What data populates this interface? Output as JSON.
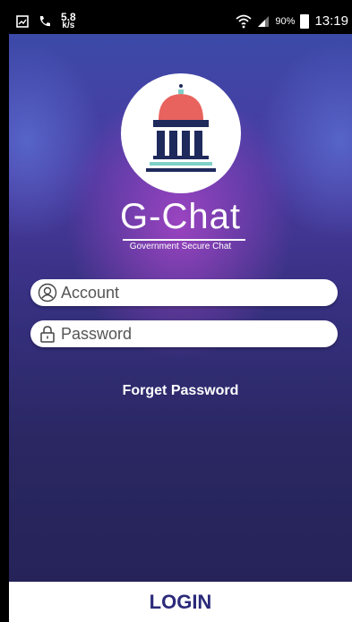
{
  "status_bar": {
    "speed_value": "5.8",
    "speed_unit": "k/s",
    "battery": "90%",
    "time": "13:19",
    "icons": [
      "gallery-icon",
      "phone-icon",
      "wifi-icon",
      "signal-icon",
      "battery-icon"
    ]
  },
  "app": {
    "title": "G-Chat",
    "subtitle": "Government Secure Chat"
  },
  "login_form": {
    "account_placeholder": "Account",
    "password_placeholder": "Password",
    "forget_label": "Forget Password",
    "login_label": "LOGIN"
  },
  "colors": {
    "login_text": "#2b2a7a",
    "dome": "#e8635e",
    "building": "#1f2a5c",
    "base_accent": "#7fd0c8"
  }
}
